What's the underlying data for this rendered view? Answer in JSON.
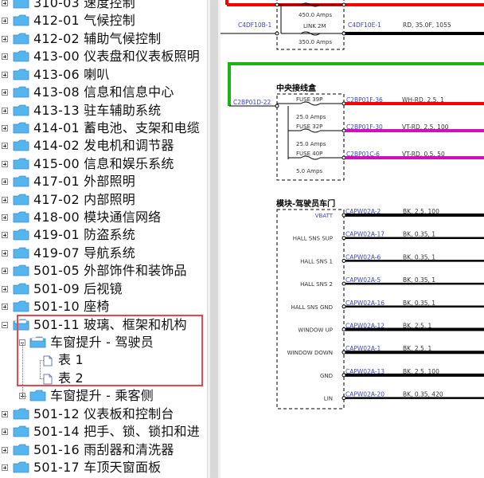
{
  "tree": {
    "items": [
      {
        "label": "310-03 速度控制",
        "expander": "plus",
        "icon": "folder"
      },
      {
        "label": "412-01 气候控制",
        "expander": "plus",
        "icon": "folder"
      },
      {
        "label": "412-02 辅助气候控制",
        "expander": "plus",
        "icon": "folder"
      },
      {
        "label": "413-00 仪表盘和仪表板照明",
        "expander": "plus",
        "icon": "folder"
      },
      {
        "label": "413-06 喇叭",
        "expander": "plus",
        "icon": "folder"
      },
      {
        "label": "413-08 信息和信息中心",
        "expander": "plus",
        "icon": "folder"
      },
      {
        "label": "413-13 驻车辅助系统",
        "expander": "plus",
        "icon": "folder"
      },
      {
        "label": "414-01 蓄电池、支架和电缆",
        "expander": "plus",
        "icon": "folder"
      },
      {
        "label": "414-02 发电机和调节器",
        "expander": "plus",
        "icon": "folder"
      },
      {
        "label": "415-00 信息和娱乐系统",
        "expander": "plus",
        "icon": "folder"
      },
      {
        "label": "417-01 外部照明",
        "expander": "plus",
        "icon": "folder"
      },
      {
        "label": "417-02 内部照明",
        "expander": "plus",
        "icon": "folder"
      },
      {
        "label": "418-00 模块通信网络",
        "expander": "plus",
        "icon": "folder"
      },
      {
        "label": "419-01 防盗系统",
        "expander": "plus",
        "icon": "folder"
      },
      {
        "label": "419-07 导航系统",
        "expander": "plus",
        "icon": "folder"
      },
      {
        "label": "501-05 外部饰件和装饰品",
        "expander": "plus",
        "icon": "folder"
      },
      {
        "label": "501-09 后视镜",
        "expander": "plus",
        "icon": "folder"
      },
      {
        "label": "501-10 座椅",
        "expander": "plus",
        "icon": "folder"
      },
      {
        "label": "501-11 玻璃、框架和机构",
        "expander": "minus",
        "icon": "folder-open"
      },
      {
        "label": "车窗提升 - 驾驶员",
        "expander": "minus",
        "icon": "folder-open"
      },
      {
        "label": "表 1",
        "expander": "none",
        "icon": "doc"
      },
      {
        "label": "表 2",
        "expander": "none",
        "icon": "doc"
      },
      {
        "label": "车窗提升 - 乘客侧",
        "expander": "plus",
        "icon": "folder"
      },
      {
        "label": "501-12 仪表板和控制台",
        "expander": "plus",
        "icon": "folder"
      },
      {
        "label": "501-14 把手、锁、锁扣和进",
        "expander": "plus",
        "icon": "folder"
      },
      {
        "label": "501-16 雨刮器和清洗器",
        "expander": "plus",
        "icon": "folder"
      },
      {
        "label": "501-17 车顶天窗面板",
        "expander": "plus",
        "icon": "folder"
      }
    ]
  },
  "colors": {
    "selection_border": "#e8474b",
    "wire_red": "#ff0000",
    "wire_green": "#1ab31a",
    "wire_magenta": "#d010b8",
    "wire_black": "#000000",
    "connector_blue": "#3a44d9",
    "folder_blue": "#55b6ef"
  },
  "diagram": {
    "top_fuse": {
      "amps": "450.0 Amps",
      "link_name": "LINK 2M",
      "link_amps": "350.0 Amps",
      "left_conn": "C4DF10B-1",
      "right_conn": "C4DF10E-1",
      "wire": "RD, 35.0F, 1055"
    },
    "junction_box": {
      "title": "中央接线盒",
      "left_conn": "C2BP01D-22",
      "fuses": [
        {
          "name": "FUSE 39P",
          "amps": "25.0 Amps",
          "conn": "C2BP01F-36",
          "wire": "WH-RD, 2.5, 1",
          "color": "#ff0000"
        },
        {
          "name": "FUSE 32P",
          "amps": "25.0 Amps",
          "conn": "C2BP01F-30",
          "wire": "VT-RD, 2.5, 100",
          "color": "#d010b8"
        },
        {
          "name": "FUSE 40P",
          "amps": "5.0 Amps",
          "conn": "C2BP01C-6",
          "wire": "VT-RD, 0.5, 50",
          "color": "#d010b8"
        }
      ]
    },
    "module": {
      "title": "模块-驾驶员车门",
      "pins": [
        {
          "name": "VBATT",
          "conn": "CAPW02A-2",
          "wire": "BK, 2.5, 100",
          "highlight": true,
          "thick": true
        },
        {
          "name": "HALL SNS SUP",
          "conn": "CAPW02A-17",
          "wire": "BK, 0.35, 1",
          "highlight": false,
          "thick": false
        },
        {
          "name": "HALL SNS 1",
          "conn": "CAPW02A-6",
          "wire": "BK, 0.35, 1",
          "highlight": false,
          "thick": false
        },
        {
          "name": "HALL SNS 2",
          "conn": "CAPW02A-5",
          "wire": "BK, 0.35, 1",
          "highlight": false,
          "thick": false
        },
        {
          "name": "HALL SNS GND",
          "conn": "CAPW02A-16",
          "wire": "BK, 0.35, 1",
          "highlight": false,
          "thick": false
        },
        {
          "name": "WINDOW UP",
          "conn": "CAPW02A-12",
          "wire": "BK, 2.5, 1",
          "highlight": false,
          "thick": true
        },
        {
          "name": "WINDOW DOWN",
          "conn": "CAPW02A-1",
          "wire": "BK, 2.5, 1",
          "highlight": false,
          "thick": true
        },
        {
          "name": "GND",
          "conn": "CAPW02A-13",
          "wire": "BK, 2.5, 100",
          "highlight": false,
          "thick": true
        },
        {
          "name": "LIN",
          "conn": "CAPW02A-20",
          "wire": "BK, 0.35, 420",
          "highlight": false,
          "thick": false
        }
      ]
    }
  }
}
